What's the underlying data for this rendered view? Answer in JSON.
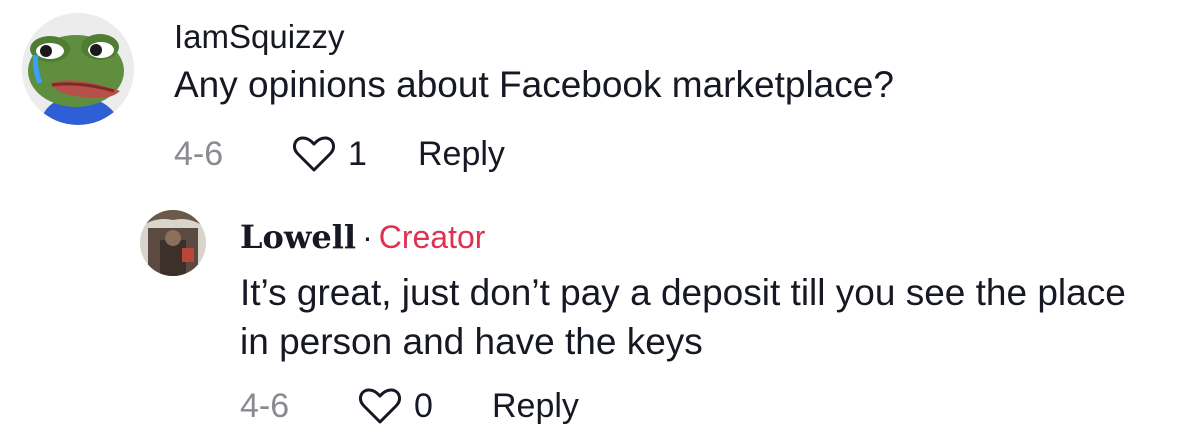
{
  "comments": [
    {
      "username": "IamSquizzy",
      "text": "Any opinions about Facebook marketplace?",
      "date": "4-6",
      "like_count": "1",
      "reply_label": "Reply",
      "avatar_icon": "frog-avatar-icon"
    },
    {
      "username": "Lowell",
      "separator": "·",
      "badge": "Creator",
      "badge_color": "#e0314e",
      "text": "It’s great, just don’t pay a deposit till you see the place in person and have the keys",
      "date": "4-6",
      "like_count": "0",
      "reply_label": "Reply",
      "avatar_icon": "user-photo-avatar-icon"
    }
  ]
}
